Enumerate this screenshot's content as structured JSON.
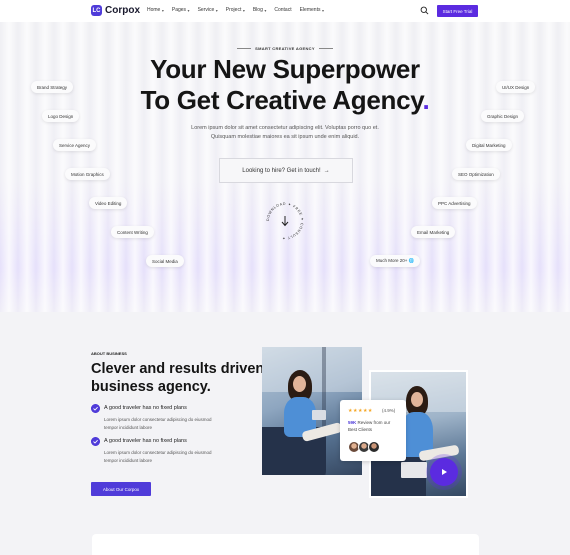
{
  "nav": {
    "logo_mark": "LC",
    "logo_text": "Corpox",
    "items": [
      {
        "label": "Home",
        "dropdown": true
      },
      {
        "label": "Pages",
        "dropdown": true
      },
      {
        "label": "Service",
        "dropdown": true
      },
      {
        "label": "Project",
        "dropdown": true
      },
      {
        "label": "Blog",
        "dropdown": true
      },
      {
        "label": "Contact",
        "dropdown": false
      },
      {
        "label": "Elements",
        "dropdown": true
      }
    ],
    "cta": "Start Free Trial",
    "search_icon": "search-icon"
  },
  "hero": {
    "eyebrow": "SMART CREATIVE AGENCY",
    "title_line1": "Your New Superpower",
    "title_line2": "To Get Creative Agency",
    "title_dot": ".",
    "subtitle": "Lorem ipsum dolor sit amet consectetur adipiscing elit. Voluptas porro quo et. Quisquam molestiae maiores ea sit ipsum unde enim aliquid.",
    "button": "Looking to hire? Get in touch!",
    "button_arrow": "→",
    "badge_text": "DOWNLOAD ✦ FREE ✦ CONSULT ✦",
    "left_tags": [
      "Brand Strategy",
      "Logo Design",
      "Service Agency",
      "Motion Graphics",
      "Video Editing",
      "Content Writing",
      "Social Media"
    ],
    "right_tags": [
      "UI/UX Design",
      "Graphic Design",
      "Digital Marketing",
      "SEO Optimization",
      "PPC Advertising",
      "Email Marketing",
      "Much More 20+ 🌐"
    ]
  },
  "about": {
    "eyebrow": "ABOUT BUSINESS",
    "title": "Clever and results driven business agency.",
    "features": [
      {
        "title": "A good traveler has no fixed plans",
        "text": "Lorem ipsum dolor consectetur adipiscing do eiusmod tempor incididunt labore"
      },
      {
        "title": "A good traveler has no fixed plans",
        "text": "Lorem ipsum dolor consectetur adipiscing do eiusmod tempor incididunt labore"
      }
    ],
    "button": "About Our Corpox",
    "review": {
      "stars": "★★★★★",
      "rating": "(4.9%)",
      "text_highlight": "59K",
      "text_rest": " Review from our Best Clients"
    },
    "play_icon": "play-icon"
  },
  "colors": {
    "accent": "#5b2be0",
    "accent_dark": "#4f3bd9",
    "star": "#f5a623"
  }
}
